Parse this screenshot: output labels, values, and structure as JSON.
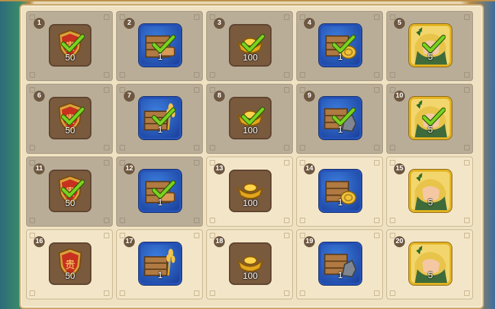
{
  "rewards": [
    {
      "n": "1",
      "qty": "50",
      "kind": "crest",
      "frame": "brown",
      "claimed": true
    },
    {
      "n": "2",
      "qty": "1",
      "kind": "crate-wood",
      "frame": "blue",
      "claimed": true
    },
    {
      "n": "3",
      "qty": "100",
      "kind": "ingot",
      "frame": "brown",
      "claimed": true
    },
    {
      "n": "4",
      "qty": "1",
      "kind": "crate-coin",
      "frame": "blue",
      "claimed": true
    },
    {
      "n": "5",
      "qty": "5",
      "kind": "hero",
      "frame": "gold",
      "claimed": true
    },
    {
      "n": "6",
      "qty": "50",
      "kind": "crest",
      "frame": "brown",
      "claimed": true
    },
    {
      "n": "7",
      "qty": "1",
      "kind": "crate-wheat",
      "frame": "blue",
      "claimed": true
    },
    {
      "n": "8",
      "qty": "100",
      "kind": "ingot",
      "frame": "brown",
      "claimed": true
    },
    {
      "n": "9",
      "qty": "1",
      "kind": "crate-stone",
      "frame": "blue",
      "claimed": true
    },
    {
      "n": "10",
      "qty": "5",
      "kind": "hero",
      "frame": "gold",
      "claimed": true
    },
    {
      "n": "11",
      "qty": "50",
      "kind": "crest",
      "frame": "brown",
      "claimed": true
    },
    {
      "n": "12",
      "qty": "1",
      "kind": "crate-wood",
      "frame": "blue",
      "claimed": true
    },
    {
      "n": "13",
      "qty": "100",
      "kind": "ingot",
      "frame": "brown",
      "claimed": false
    },
    {
      "n": "14",
      "qty": "1",
      "kind": "crate-coin",
      "frame": "blue",
      "claimed": false
    },
    {
      "n": "15",
      "qty": "5",
      "kind": "hero",
      "frame": "gold",
      "claimed": false
    },
    {
      "n": "16",
      "qty": "50",
      "kind": "crest",
      "frame": "brown",
      "claimed": false
    },
    {
      "n": "17",
      "qty": "1",
      "kind": "crate-wheat",
      "frame": "blue",
      "claimed": false
    },
    {
      "n": "18",
      "qty": "100",
      "kind": "ingot",
      "frame": "brown",
      "claimed": false
    },
    {
      "n": "19",
      "qty": "1",
      "kind": "crate-stone",
      "frame": "blue",
      "claimed": false
    },
    {
      "n": "20",
      "qty": "5",
      "kind": "hero",
      "frame": "gold",
      "claimed": false
    }
  ],
  "crest_glyph": "贵",
  "colors": {
    "check": "#7ad21e",
    "claimed_bg": "#b9ad97",
    "open_bg": "#f3e6c8"
  }
}
